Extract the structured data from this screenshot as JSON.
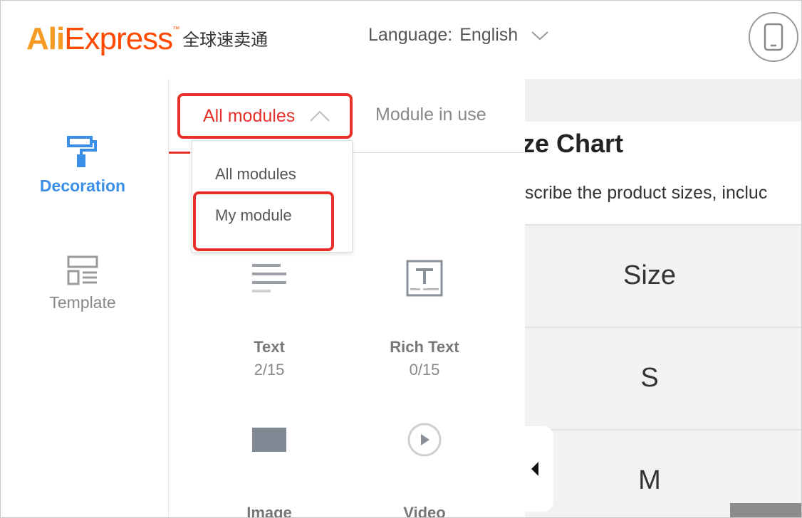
{
  "header": {
    "logo_text_1": "Ali",
    "logo_text_2": "Express",
    "logo_tm": "™",
    "logo_cn": "全球速卖通",
    "language_label": "Language:",
    "language_value": "English"
  },
  "sidebar": {
    "items": [
      {
        "label": "Decoration",
        "icon": "paint-roller-icon",
        "active": true
      },
      {
        "label": "Template",
        "icon": "template-layout-icon",
        "active": false
      }
    ]
  },
  "modules_panel": {
    "tabs": [
      {
        "label": "All modules",
        "active": true
      },
      {
        "label": "Module in use",
        "active": false
      }
    ],
    "dropdown": {
      "options": [
        "All modules",
        "My module"
      ],
      "highlighted": "My module"
    },
    "modules": [
      {
        "name": "Text",
        "count": "2/15",
        "icon": "text-lines-icon"
      },
      {
        "name": "Rich Text",
        "count": "0/15",
        "icon": "rich-text-icon"
      },
      {
        "name": "Image",
        "icon": "image-icon"
      },
      {
        "name": "Video",
        "icon": "play-icon"
      }
    ]
  },
  "preview": {
    "title": "ize Chart",
    "description": "escribe the product sizes, incluc",
    "table_rows": [
      "Size",
      "S",
      "M"
    ]
  },
  "colors": {
    "accent_red": "#e8302a",
    "active_blue": "#3a8ee6",
    "logo_orange": "#f59a23",
    "logo_red": "#ff4a00"
  }
}
